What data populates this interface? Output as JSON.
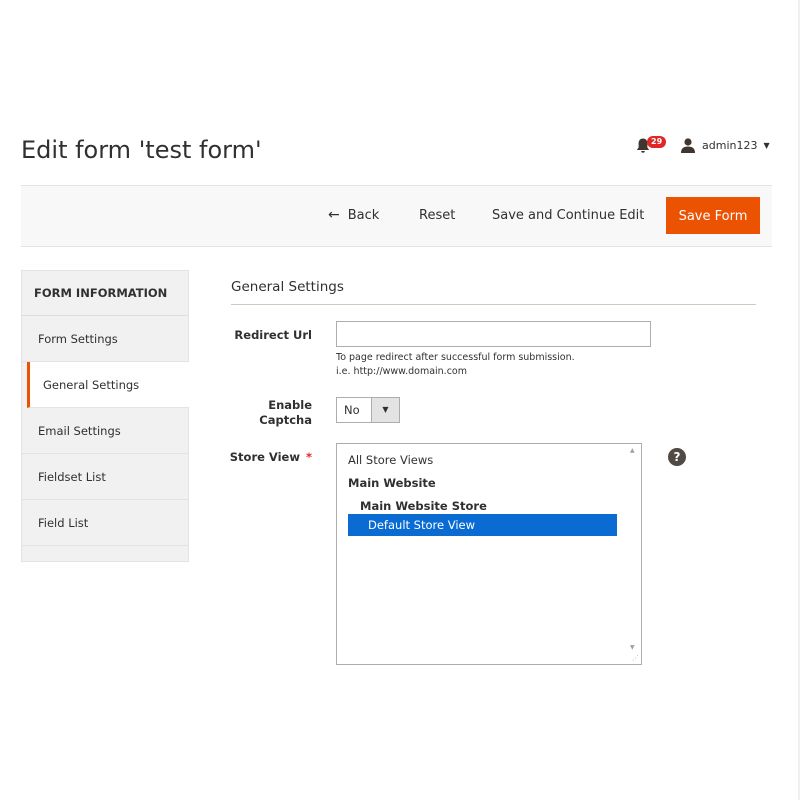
{
  "header": {
    "title": "Edit form 'test form'",
    "notifications_count": "29",
    "username": "admin123",
    "bell_icon": "bell-icon",
    "user_icon": "user-icon"
  },
  "toolbar": {
    "back_label": "Back",
    "reset_label": "Reset",
    "save_continue_label": "Save and Continue Edit",
    "save_label": "Save Form",
    "save_color": "#eb5202"
  },
  "sidebar": {
    "title": "FORM INFORMATION",
    "items": [
      {
        "label": "Form Settings"
      },
      {
        "label": "General Settings"
      },
      {
        "label": "Email Settings"
      },
      {
        "label": "Fieldset List"
      },
      {
        "label": "Field List"
      }
    ],
    "active_index": 1,
    "active_accent": "#eb5202"
  },
  "section": {
    "title": "General Settings"
  },
  "fields": {
    "redirect_url": {
      "label": "Redirect Url",
      "value": "",
      "note_line1": "To page redirect after successful form submission.",
      "note_line2": "i.e. http://www.domain.com"
    },
    "enable_captcha": {
      "label_line1": "Enable",
      "label_line2": "Captcha",
      "selected": "No"
    },
    "store_view": {
      "label": "Store View",
      "required_mark": "*",
      "options": [
        {
          "label": "All Store Views"
        },
        {
          "label": "Main Website"
        },
        {
          "label": "Main Website Store"
        },
        {
          "label": "Default Store View"
        }
      ],
      "selected": "Default Store View",
      "selected_color": "#0a6cd3",
      "help_icon": "question-circle-icon",
      "help_label": "?"
    }
  }
}
